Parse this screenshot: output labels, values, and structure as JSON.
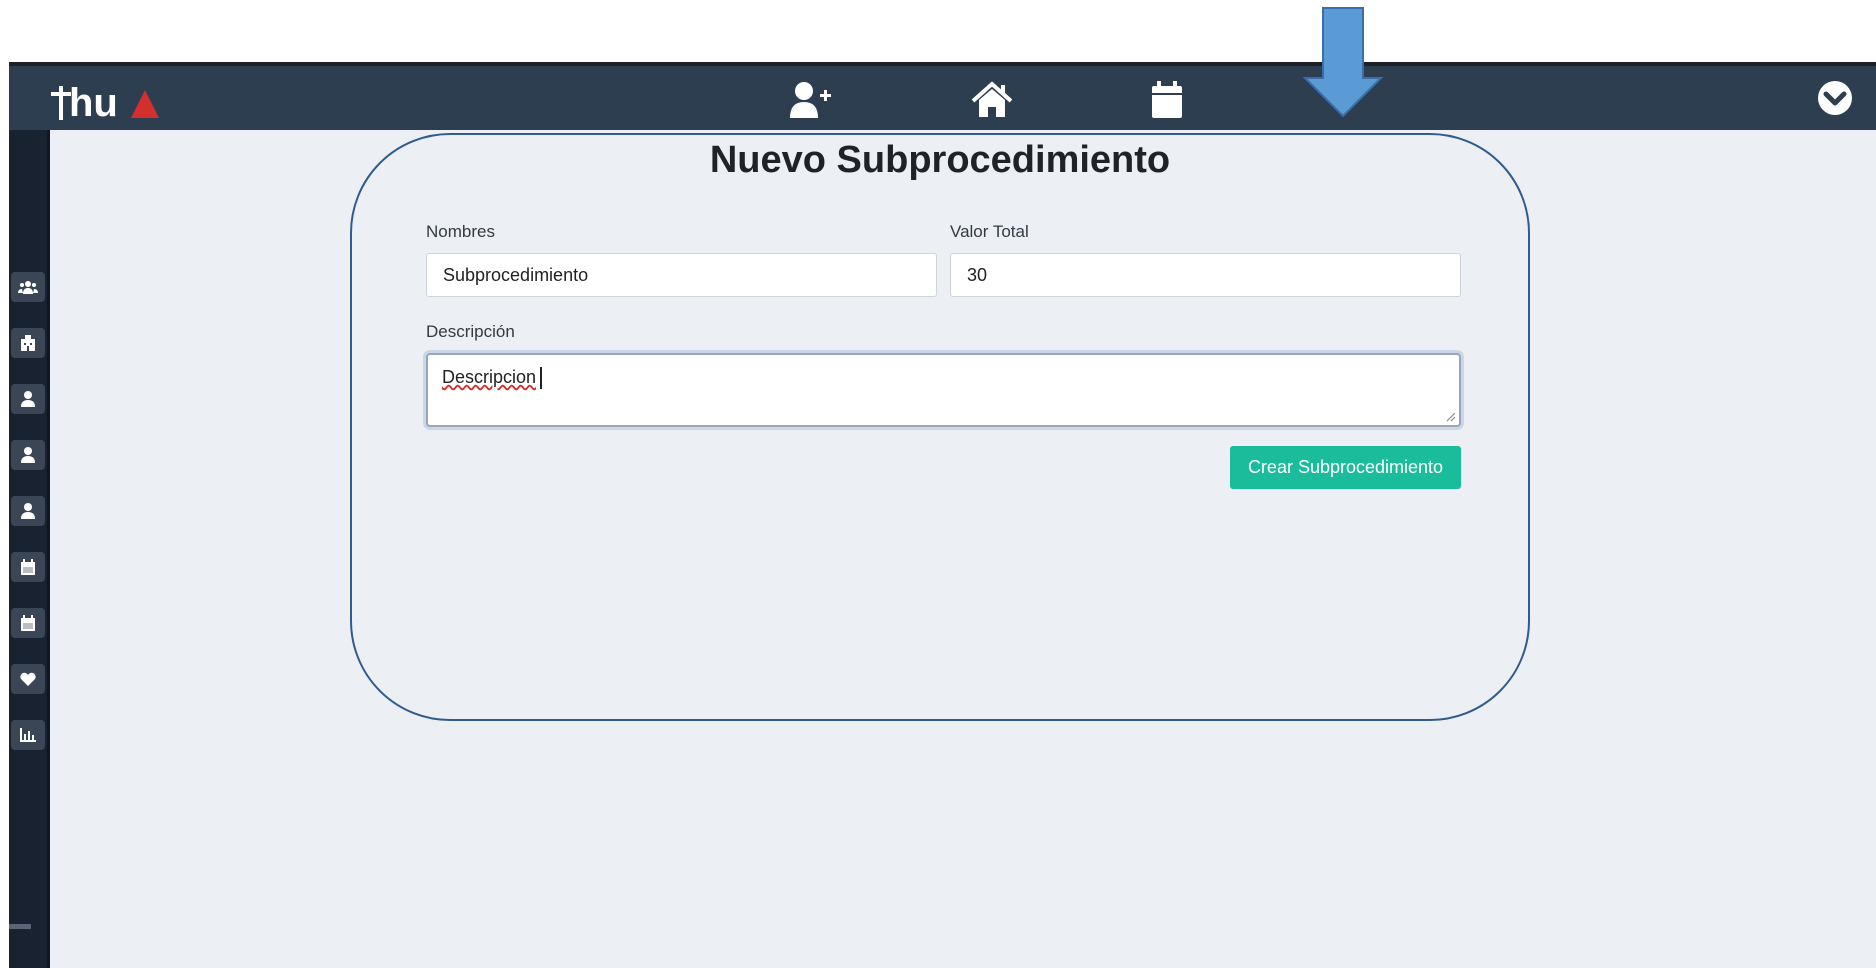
{
  "app": {
    "logo_text": "hu",
    "accent_color": "#1abc9c",
    "navbar_color": "#2d3e50"
  },
  "navbar": {
    "icons": [
      "add-user-icon",
      "home-icon",
      "calendar-icon"
    ],
    "account_menu_icon": "chevron-circle-down-icon"
  },
  "sidebar": {
    "icons": [
      "users-icon",
      "hospital-icon",
      "user-doctor-icon",
      "user-doctor-icon",
      "user-doctor-icon",
      "calendar-icon",
      "calendar-icon",
      "heart-icon",
      "chart-bar-icon"
    ]
  },
  "form": {
    "title": "Nuevo Subprocedimiento",
    "nombres_label": "Nombres",
    "nombres_value": "Subprocedimiento",
    "valor_label": "Valor Total",
    "valor_value": "30",
    "descripcion_label": "Descripción",
    "descripcion_value": "Descripcion",
    "submit_label": "Crear Subprocedimiento"
  },
  "annotation": {
    "arrow_color": "#5b9bd5",
    "arrow_direction": "down"
  }
}
